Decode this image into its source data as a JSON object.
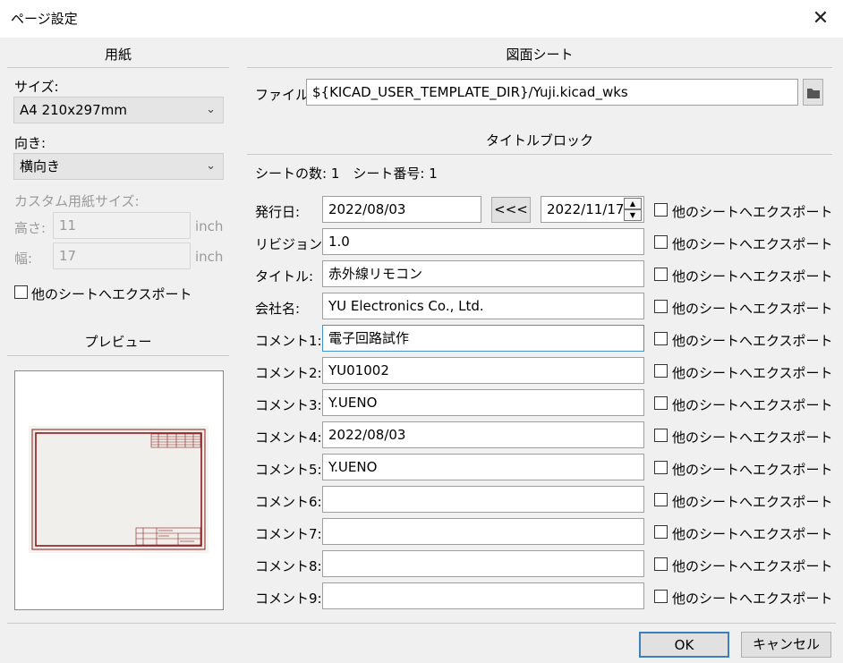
{
  "window": {
    "title": "ページ設定"
  },
  "paper": {
    "heading": "用紙",
    "size_label": "サイズ:",
    "size_value": "A4 210x297mm",
    "orientation_label": "向き:",
    "orientation_value": "横向き",
    "custom_label": "カスタム用紙サイズ:",
    "height_label": "高さ:",
    "height_value": "11",
    "height_unit": "inch",
    "width_label": "幅:",
    "width_value": "17",
    "width_unit": "inch",
    "export_label": "他のシートへエクスポート",
    "preview_heading": "プレビュー"
  },
  "sheet": {
    "heading": "図面シート",
    "file_label": "ファイル:",
    "file_value": "${KICAD_USER_TEMPLATE_DIR}/Yuji.kicad_wks",
    "titleblock_heading": "タイトルブロック",
    "sheet_info": "シートの数: 1　シート番号: 1",
    "copy_date_button": "<<<",
    "date_picker_value": "2022/11/17",
    "export_label": "他のシートへエクスポート",
    "fields": [
      {
        "label": "発行日:",
        "value": "2022/08/03"
      },
      {
        "label": "リビジョン:",
        "value": "1.0"
      },
      {
        "label": "タイトル:",
        "value": "赤外線リモコン"
      },
      {
        "label": "会社名:",
        "value": "YU Electronics Co., Ltd."
      },
      {
        "label": "コメント1:",
        "value": "電子回路試作"
      },
      {
        "label": "コメント2:",
        "value": "YU01002"
      },
      {
        "label": "コメント3:",
        "value": "Y.UENO"
      },
      {
        "label": "コメント4:",
        "value": "2022/08/03"
      },
      {
        "label": "コメント5:",
        "value": "Y.UENO"
      },
      {
        "label": "コメント6:",
        "value": ""
      },
      {
        "label": "コメント7:",
        "value": ""
      },
      {
        "label": "コメント8:",
        "value": ""
      },
      {
        "label": "コメント9:",
        "value": ""
      }
    ]
  },
  "footer": {
    "ok_label": "OK",
    "cancel_label": "キャンセル"
  }
}
